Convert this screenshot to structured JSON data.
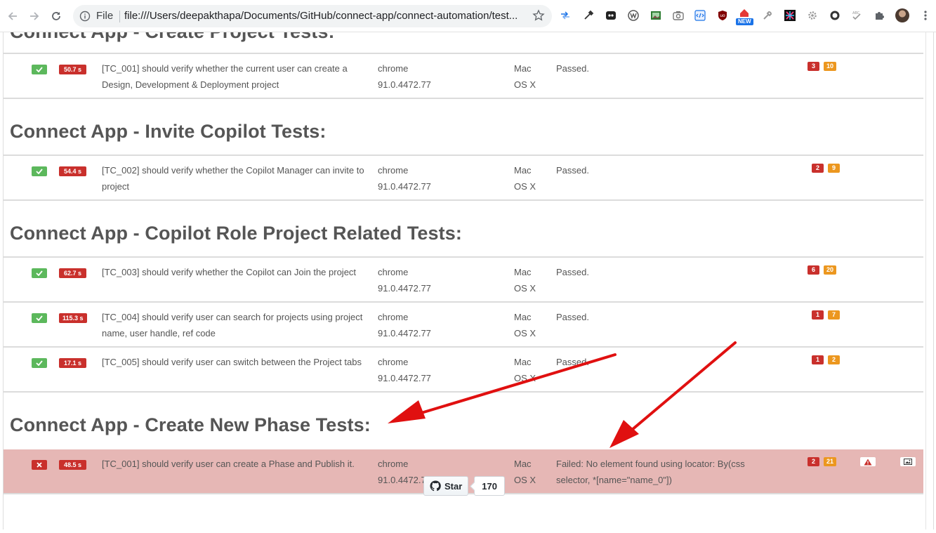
{
  "browser": {
    "scheme_label": "File",
    "url": "file:///Users/deepakthapa/Documents/GitHub/connect-app/connect-automation/test...",
    "new_badge": "NEW",
    "extensions": [
      "arrows-icon",
      "eyedropper-icon",
      "bitmoji-icon",
      "wappalyzer-icon",
      "image-icon",
      "camera-icon",
      "code-icon",
      "ublock-icon",
      "new-extension-icon",
      "wrench-icon",
      "pinwheel-icon",
      "gear-icon",
      "circle-icon",
      "spellcheck-icon",
      "puzzle-icon"
    ]
  },
  "report": {
    "sections": [
      {
        "title": "Connect App - Create Project Tests:",
        "tests": [
          {
            "status": "passed",
            "duration": "50.7 s",
            "title": "[TC_001] should verify whether the current user can create a Design, Development & Deployment project",
            "browser": "chrome 91.0.4472.77",
            "os": "Mac OS X",
            "result": "Passed.",
            "badge_red": "3",
            "badge_orange": "10"
          }
        ]
      },
      {
        "title": "Connect App - Invite Copilot Tests:",
        "tests": [
          {
            "status": "passed",
            "duration": "54.4 s",
            "title": "[TC_002] should verify whether the Copilot Manager can invite to project",
            "browser": "chrome 91.0.4472.77",
            "os": "Mac OS X",
            "result": "Passed.",
            "badge_red": "2",
            "badge_orange": "9"
          }
        ]
      },
      {
        "title": "Connect App - Copilot Role Project Related Tests:",
        "tests": [
          {
            "status": "passed",
            "duration": "62.7 s",
            "title": "[TC_003] should verify whether the Copilot can Join the project",
            "browser": "chrome 91.0.4472.77",
            "os": "Mac OS X",
            "result": "Passed.",
            "badge_red": "6",
            "badge_orange": "20"
          },
          {
            "status": "passed",
            "duration": "115.3 s",
            "title": "[TC_004] should verify user can search for projects using project name, user handle, ref code",
            "browser": "chrome 91.0.4472.77",
            "os": "Mac OS X",
            "result": "Passed.",
            "badge_red": "1",
            "badge_orange": "7"
          },
          {
            "status": "passed",
            "duration": "17.1 s",
            "title": "[TC_005] should verify user can switch between the Project tabs",
            "browser": "chrome 91.0.4472.77",
            "os": "Mac OS X",
            "result": "Passed.",
            "badge_red": "1",
            "badge_orange": "2"
          }
        ]
      },
      {
        "title": "Connect App - Create New Phase Tests:",
        "tests": [
          {
            "status": "failed",
            "duration": "48.5 s",
            "title": "[TC_001] should verify user can create a Phase and Publish it.",
            "browser": "chrome 91.0.4472.77",
            "os": "Mac OS X",
            "result": "Failed: No element found using locator: By(css selector, *[name=\"name_0\"])",
            "badge_red": "2",
            "badge_orange": "21",
            "icons": [
              "warning-icon",
              "screenshot-icon"
            ]
          }
        ]
      }
    ]
  },
  "footer": {
    "star_label": "Star",
    "star_count": "170"
  },
  "colors": {
    "passed": "#5cb85c",
    "failed": "#c9302c",
    "failed_row": "#e6b7b5",
    "warn_badge": "#ec971f",
    "annotation_arrow": "#e01010"
  }
}
